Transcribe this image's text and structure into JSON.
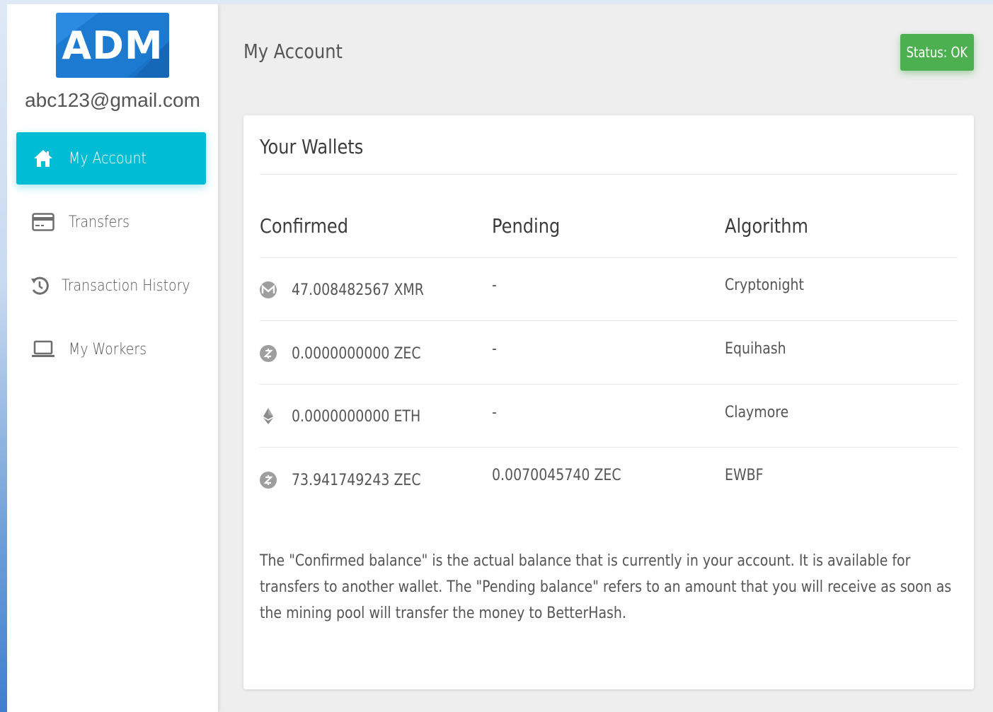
{
  "brand": {
    "logo_text": "ADM",
    "logo_color": "#1d7ad0"
  },
  "user": {
    "email": "abc123@gmail.com"
  },
  "sidebar": {
    "items": [
      {
        "label": "My Account",
        "icon": "home-icon",
        "active": true
      },
      {
        "label": "Transfers",
        "icon": "credit-card-icon",
        "active": false
      },
      {
        "label": "Transaction History",
        "icon": "history-icon",
        "active": false
      },
      {
        "label": "My Workers",
        "icon": "laptop-icon",
        "active": false
      }
    ],
    "active_color": "#00bcd4"
  },
  "header": {
    "title": "My Account",
    "status_label": "Status: OK",
    "status_color": "#4caf50"
  },
  "wallets": {
    "title": "Your Wallets",
    "columns": [
      "Confirmed",
      "Pending",
      "Algorithm"
    ],
    "rows": [
      {
        "icon": "monero-icon",
        "confirmed": "47.008482567 XMR",
        "pending": "-",
        "algorithm": "Cryptonight"
      },
      {
        "icon": "zcash-icon",
        "confirmed": "0.0000000000 ZEC",
        "pending": "-",
        "algorithm": "Equihash"
      },
      {
        "icon": "ethereum-icon",
        "confirmed": "0.0000000000 ETH",
        "pending": "-",
        "algorithm": "Claymore"
      },
      {
        "icon": "zcash-icon",
        "confirmed": "73.941749243 ZEC",
        "pending": "0.0070045740 ZEC",
        "algorithm": "EWBF"
      }
    ],
    "note": "The \"Confirmed balance\" is the actual balance that is currently in your account. It is available for transfers to another wallet. The \"Pending balance\" refers to an amount that you will receive as soon as the mining pool will transfer the money to BetterHash."
  }
}
